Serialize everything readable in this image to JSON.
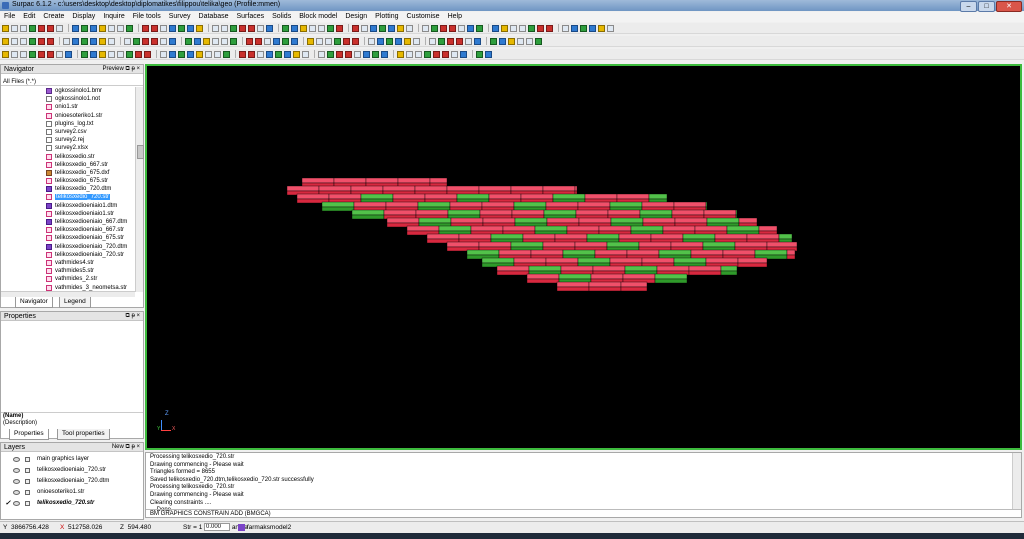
{
  "window": {
    "title": "Surpac 6.1.2 - c:\\users\\desktop\\desktop\\diplomatikes\\filippou\\telika\\geo (Profile:mmen)",
    "minimize": "–",
    "maximize": "□",
    "close": "✕"
  },
  "menu": [
    "File",
    "Edit",
    "Create",
    "Display",
    "Inquire",
    "File tools",
    "Survey",
    "Database",
    "Surfaces",
    "Solids",
    "Block model",
    "Design",
    "Plotting",
    "Customise",
    "Help"
  ],
  "navigator": {
    "title": "Navigator",
    "preview_label": "Preview",
    "filter": "All Files (*.*)",
    "files": [
      {
        "name": "ogkossinolo1.bmr",
        "type": "bmr"
      },
      {
        "name": "ogkossinolo1.not",
        "type": "txt"
      },
      {
        "name": "onio1.str",
        "type": "str"
      },
      {
        "name": "onioesoteriko1.str",
        "type": "str"
      },
      {
        "name": "plugins_log.txt",
        "type": "txt"
      },
      {
        "name": "survey2.csv",
        "type": "txt"
      },
      {
        "name": "survey2.rej",
        "type": "txt"
      },
      {
        "name": "survey2.xlsx",
        "type": "txt"
      },
      {
        "name": "telikosxedio.str",
        "type": "str"
      },
      {
        "name": "telikosxedio_667.str",
        "type": "str"
      },
      {
        "name": "telikosxedio_675.dxf",
        "type": "dxf"
      },
      {
        "name": "telikosxedio_675.str",
        "type": "str"
      },
      {
        "name": "telikosxedio_720.dtm",
        "type": "dtm"
      },
      {
        "name": "telikosxedio_720.str",
        "type": "str",
        "selected": true
      },
      {
        "name": "telikosxedioeniaio1.dtm",
        "type": "dtm"
      },
      {
        "name": "telikosxedioeniaio1.str",
        "type": "str"
      },
      {
        "name": "telikosxedioeniaio_667.dtm",
        "type": "dtm"
      },
      {
        "name": "telikosxedioeniaio_667.str",
        "type": "str"
      },
      {
        "name": "telikosxedioeniaio_675.str",
        "type": "str"
      },
      {
        "name": "telikosxedioeniaio_720.dtm",
        "type": "dtm"
      },
      {
        "name": "telikosxedioeniaio_720.str",
        "type": "str"
      },
      {
        "name": "vathmides4.str",
        "type": "str"
      },
      {
        "name": "vathmides5.str",
        "type": "str"
      },
      {
        "name": "vathmides_2.str",
        "type": "str"
      },
      {
        "name": "vathmides_3_neometsa.str",
        "type": "str"
      }
    ],
    "tab_navigator": "Navigator",
    "tab_legend": "Legend"
  },
  "properties": {
    "title": "Properties",
    "name_label": "(Name)",
    "description_label": "(Description)",
    "tab_properties": "Properties",
    "tab_tool_properties": "Tool properties"
  },
  "layers": {
    "title": "Layers",
    "new_label": "New",
    "items": [
      {
        "name": "main graphics layer",
        "active": false
      },
      {
        "name": "telikosxedioeniaio_720.str",
        "active": false
      },
      {
        "name": "telikosxedioeniaio_720.dtm",
        "active": false
      },
      {
        "name": "onioesoteriko1.str",
        "active": false
      },
      {
        "name": "telikosxedio_720.str",
        "active": true
      }
    ]
  },
  "viewport": {
    "axis_z": "Z",
    "axis_y": "Y",
    "axis_x": "X",
    "block_colors": {
      "red": "#d8283f",
      "red_light": "#f0506a",
      "green": "#2f9a2a",
      "green_light": "#52c24a"
    },
    "border_color": "#3dbb3d"
  },
  "messages": [
    "Processing telikosxedio_720.str",
    "Drawing commencing - Please wait",
    "Triangles formed = 8655",
    "Saved telikosxedio_720.dtm,telikosxedio_720.str successfully",
    "Processing telikosxedio_720.str",
    "Drawing commencing - Please wait",
    "Clearing constraints ....",
    "... Done"
  ],
  "command_line": "BM GRAPHICS CONSTRAIN ADD (BMGCA)",
  "status": {
    "y_label": "Y",
    "y_value": "3866756.428",
    "x_label": "X",
    "x_value": "512758.026",
    "z_label": "Z",
    "z_value": "594.480",
    "str_label": "Str =",
    "str_value": "1",
    "angle_value": "0.000",
    "angle_label": "angle",
    "model_name": "farmaksmodel2"
  }
}
